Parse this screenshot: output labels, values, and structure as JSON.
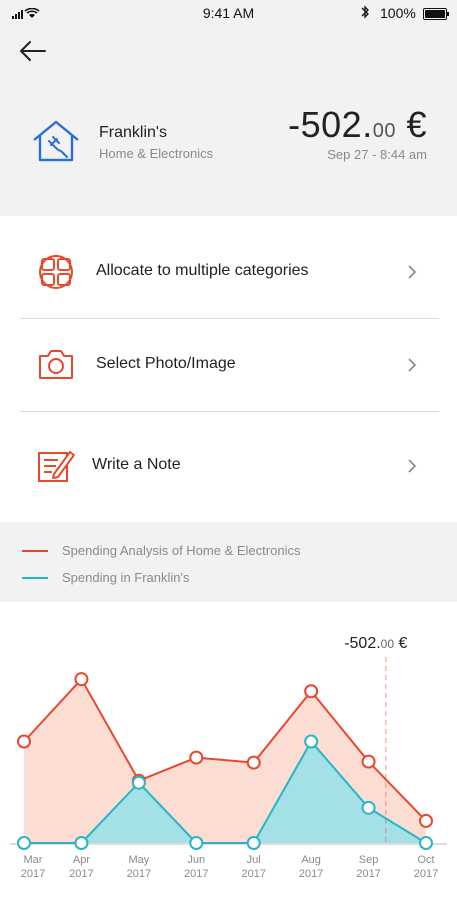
{
  "status_bar": {
    "time": "9:41 AM",
    "battery": "100%"
  },
  "transaction": {
    "merchant": "Franklin's",
    "category": "Home & Electronics",
    "amount_main": "-502.",
    "amount_cents": "00",
    "currency": "€",
    "datetime": "Sep 27  -  8:44 am"
  },
  "actions": [
    {
      "label": "Allocate to multiple categories",
      "icon": "grid-split-icon"
    },
    {
      "label": "Select Photo/Image",
      "icon": "camera-icon"
    },
    {
      "label": "Write a Note",
      "icon": "note-pencil-icon"
    }
  ],
  "legend": [
    {
      "label": "Spending Analysis of Home & Electronics",
      "color": "#e8482e"
    },
    {
      "label": "Spending in Franklin's",
      "color": "#29b5c6"
    }
  ],
  "colors": {
    "accent": "#e8482e",
    "secondary": "#29b5c6",
    "muted": "#8a8a8a",
    "header_bg": "#f2f2f2"
  },
  "chart_data": {
    "type": "area",
    "categories": [
      "Mar\n2017",
      "Apr\n2017",
      "May\n2017",
      "Jun\n2017",
      "Jul\n2017",
      "Aug\n2017",
      "Sep\n2017",
      "Oct\n2017"
    ],
    "series": [
      {
        "name": "Spending Analysis of Home & Electronics",
        "values": [
          505,
          815,
          310,
          425,
          400,
          755,
          405,
          110
        ]
      },
      {
        "name": "Spending in Franklin's",
        "values": [
          0,
          0,
          300,
          0,
          0,
          505,
          175,
          0
        ]
      }
    ],
    "ylim": [
      0,
      1000
    ],
    "marker": {
      "category_index": 6.3,
      "label_main": "-502.",
      "label_cents": "00",
      "label_currency": "€"
    },
    "grid": false
  }
}
